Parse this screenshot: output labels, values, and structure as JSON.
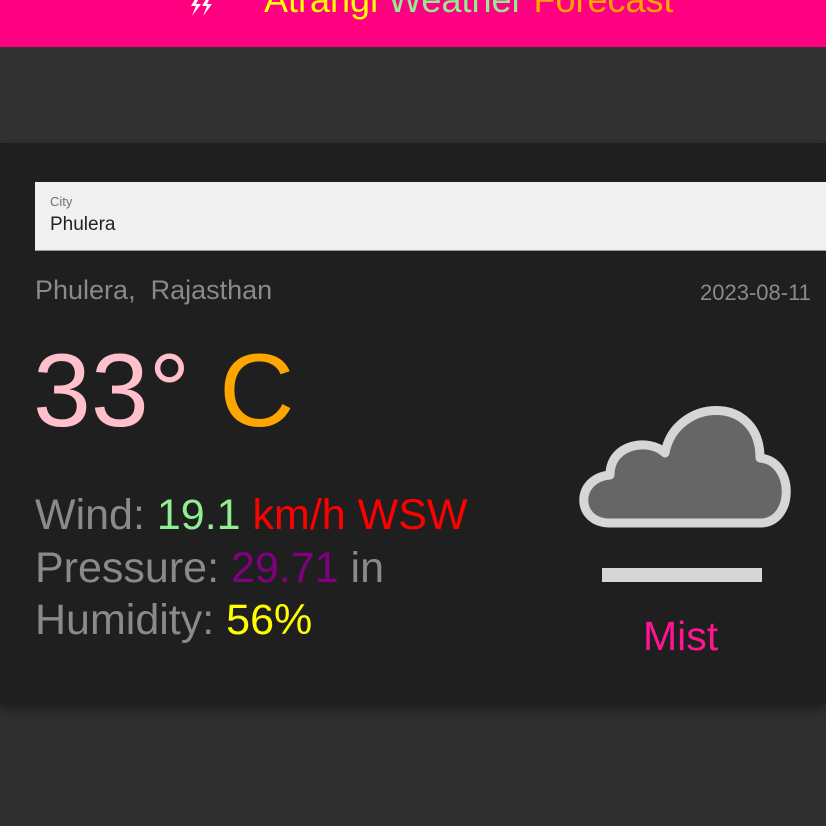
{
  "header": {
    "title_part1": "Atrangi",
    "title_part2": "Weather",
    "title_part3": "Forecast",
    "icon": "lightning-icon",
    "colors": {
      "background": "#ff0080",
      "part1": "#ffff00",
      "part2": "#90ee90",
      "part3": "#ffa500"
    }
  },
  "search": {
    "label": "City",
    "value": "Phulera"
  },
  "location": {
    "city": "Phulera,",
    "region": "Rajasthan"
  },
  "date": "2023-08-11",
  "temperature": {
    "value": "33°",
    "unit": "C"
  },
  "stats": {
    "wind_label": "Wind:",
    "wind_value": "19.1",
    "wind_unit": "km/h WSW",
    "pressure_label": "Pressure:",
    "pressure_value": "29.71",
    "pressure_unit": "in",
    "humidity_label": "Humidity:",
    "humidity_value": "56%"
  },
  "condition": {
    "text": "Mist",
    "icon": "mist-cloud-icon",
    "color": "#ff1493"
  }
}
